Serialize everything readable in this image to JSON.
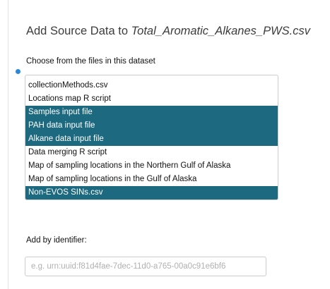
{
  "dialog": {
    "title_prefix": "Add Source Data to ",
    "title_filename": "Total_Aromatic_Alkanes_PWS.csv",
    "choose_label": "Choose from the files in this dataset",
    "files": [
      {
        "label": "collectionMethods.csv",
        "selected": false
      },
      {
        "label": "Locations map R script",
        "selected": false
      },
      {
        "label": "Samples input file",
        "selected": true
      },
      {
        "label": "PAH data input file",
        "selected": true
      },
      {
        "label": "Alkane data input file",
        "selected": true
      },
      {
        "label": "Data merging R script",
        "selected": false
      },
      {
        "label": "Map of sampling locations in the Northern Gulf of Alaska",
        "selected": false
      },
      {
        "label": "Map of sampling locations in the Gulf of Alaska",
        "selected": false
      },
      {
        "label": "Non-EVOS SINs.csv",
        "selected": true
      }
    ],
    "identifier_label": "Add by identifier:",
    "identifier_value": "",
    "identifier_placeholder": "e.g. urn:uuid:f81d4fae-7dec-11d0-a765-00a0c91e6bf6"
  },
  "colors": {
    "selected_background": "#1d6a80",
    "focus_dot": "#2b88d8"
  }
}
